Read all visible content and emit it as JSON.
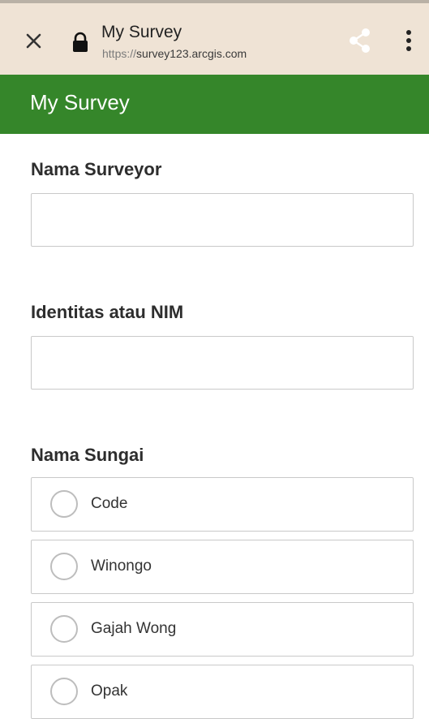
{
  "browser": {
    "title": "My Survey",
    "url_scheme": "https://",
    "url_host": "survey123.arcgis.com",
    "close_icon": "close-icon",
    "lock_icon": "lock-icon",
    "share_icon": "share-icon",
    "more_icon": "more-vertical-icon"
  },
  "appbar": {
    "title": "My Survey",
    "color": "#35862a"
  },
  "form": {
    "surveyor": {
      "label": "Nama Surveyor",
      "value": ""
    },
    "identity": {
      "label": "Identitas atau NIM",
      "value": ""
    },
    "river": {
      "label": "Nama Sungai",
      "options": [
        {
          "label": "Code",
          "selected": false
        },
        {
          "label": "Winongo",
          "selected": false
        },
        {
          "label": "Gajah Wong",
          "selected": false
        },
        {
          "label": "Opak",
          "selected": false
        }
      ]
    }
  }
}
